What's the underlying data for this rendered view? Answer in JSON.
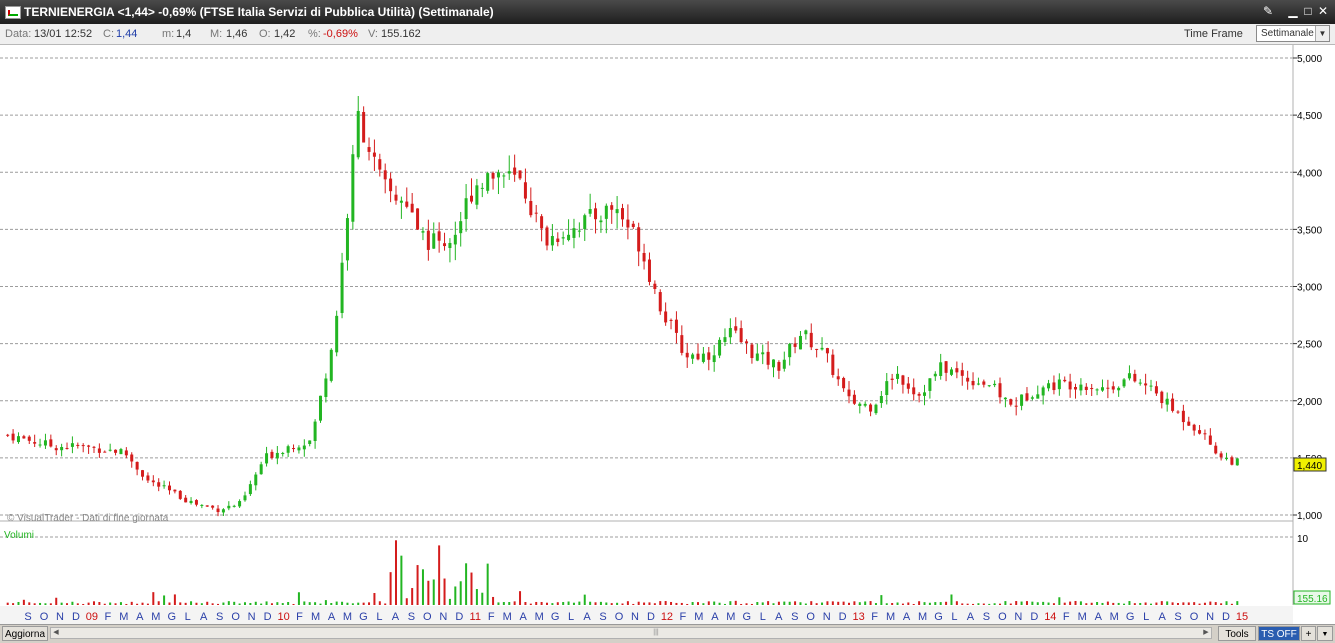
{
  "window": {
    "title": "TERNIENERGIA <1,44> -0,69%  (FTSE Italia Servizi di Pubblica Utilità)  (Settimanale)",
    "controls": [
      "tools",
      "minimize",
      "maximize",
      "close"
    ]
  },
  "infobar": {
    "data_label": "Data:",
    "data_value": "13/01 12:52",
    "close_label": "C:",
    "close_value": "1,44",
    "min_label": "m:",
    "min_value": "1,4",
    "max_label": "M:",
    "max_value": "1,46",
    "open_label": "O:",
    "open_value": "1,42",
    "pct_label": "%:",
    "pct_value": "-0,69%",
    "vol_label": "V:",
    "vol_value": "155.162",
    "timeframe_label": "Time Frame",
    "timeframe_value": "Settimanale"
  },
  "chart_data": {
    "type": "candlestick",
    "frequency": "weekly",
    "ylim": [
      1.0,
      5.0
    ],
    "y_ticks": [
      "5,000",
      "4,500",
      "4,000",
      "3,500",
      "3,000",
      "2,500",
      "2,000",
      "1,500",
      "1,000"
    ],
    "last_price_label": "1,440",
    "watermark": "© VisualTrader - Dati di fine giornata",
    "volume_label": "Volumi",
    "volume_tick": "10",
    "volume_last_label": "155.16",
    "x_labels": [
      "S",
      "O",
      "N",
      "D",
      "09",
      "F",
      "M",
      "A",
      "M",
      "G",
      "L",
      "A",
      "S",
      "O",
      "N",
      "D",
      "10",
      "F",
      "M",
      "A",
      "M",
      "G",
      "L",
      "A",
      "S",
      "O",
      "N",
      "D",
      "11",
      "F",
      "M",
      "A",
      "M",
      "G",
      "L",
      "A",
      "S",
      "O",
      "N",
      "D",
      "12",
      "F",
      "M",
      "A",
      "M",
      "G",
      "L",
      "A",
      "S",
      "O",
      "N",
      "D",
      "13",
      "F",
      "M",
      "A",
      "M",
      "G",
      "L",
      "A",
      "S",
      "O",
      "N",
      "D",
      "14",
      "F",
      "M",
      "A",
      "M",
      "G",
      "L",
      "A",
      "S",
      "O",
      "N",
      "D",
      "15"
    ],
    "year_labels": [
      "09",
      "10",
      "11",
      "12",
      "13",
      "14",
      "15"
    ],
    "close_path_monthly": [
      1.7,
      1.65,
      1.6,
      1.6,
      1.58,
      1.55,
      1.3,
      1.2,
      1.1,
      1.05,
      1.1,
      1.5,
      1.6,
      1.65,
      2.6,
      4.5,
      3.9,
      3.7,
      3.4,
      3.4,
      3.9,
      4.0,
      3.9,
      3.4,
      3.5,
      3.6,
      3.7,
      3.4,
      2.8,
      2.4,
      2.4,
      2.6,
      2.4,
      2.3,
      2.6,
      2.4,
      2.0,
      1.95,
      2.25,
      2.05,
      2.3,
      2.2,
      2.15,
      1.95,
      2.1,
      2.15,
      2.15,
      2.1,
      2.2,
      2.1,
      1.9,
      1.75,
      1.5,
      1.44
    ]
  },
  "bottom": {
    "update_label": "Aggiorna",
    "tools_label": "Tools",
    "tsoff_label": "TS OFF",
    "plus_label": "+",
    "dropdown_label": "▼"
  },
  "colors": {
    "up": "#22b522",
    "down": "#d41c1c",
    "grid": "#9c9c9c",
    "month_label": "#2a3fa8",
    "year_label": "#cc1010",
    "price_tag": "#f0f000"
  }
}
